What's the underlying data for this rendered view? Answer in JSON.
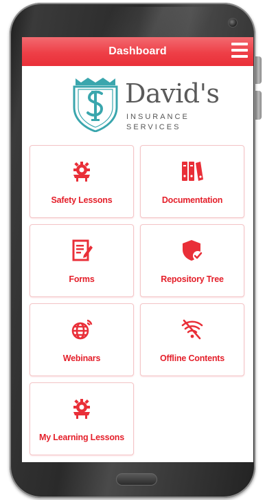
{
  "app_bar": {
    "title": "Dashboard",
    "menu_icon": "hamburger-menu-icon"
  },
  "logo": {
    "name": "David's",
    "line1": "INSURANCE",
    "line2": "SERVICES",
    "crest_icon": "shield-crest-logo",
    "colors": {
      "crest": "#3aa6ad",
      "wordmark": "#5a5a5a"
    }
  },
  "tiles": [
    {
      "label": "Safety Lessons",
      "icon": "gear-safety-icon"
    },
    {
      "label": "Documentation",
      "icon": "binders-icon"
    },
    {
      "label": "Forms",
      "icon": "form-edit-icon"
    },
    {
      "label": "Repository Tree",
      "icon": "shield-check-icon"
    },
    {
      "label": "Webinars",
      "icon": "globe-signal-icon"
    },
    {
      "label": "Offline Contents",
      "icon": "wifi-off-icon"
    },
    {
      "label": "My Learning Lessons",
      "icon": "gear-safety-icon"
    }
  ],
  "colors": {
    "accent": "#e92f38",
    "tile_border": "#f3c4c6",
    "label": "#e41f2a"
  }
}
